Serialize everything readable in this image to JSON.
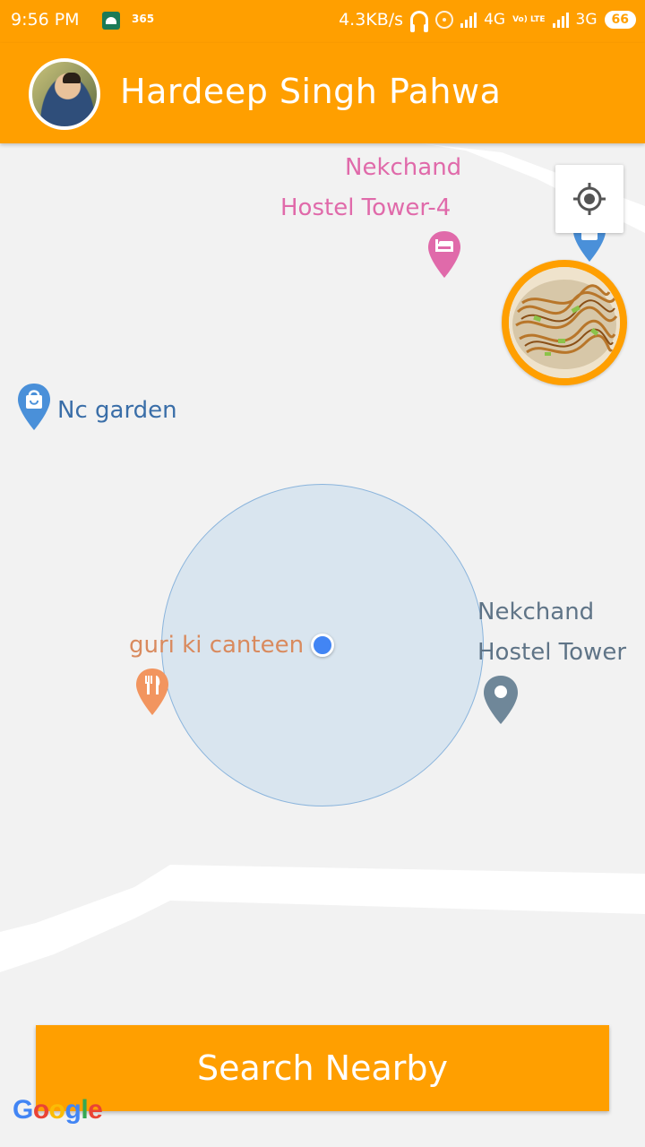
{
  "status_bar": {
    "time": "9:56 PM",
    "app_badge": "365",
    "net_speed": "4.3KB/s",
    "net_type_1": "4G",
    "net_type_2": "3G",
    "volte": "Vo) LTE",
    "battery": "66"
  },
  "header": {
    "user_name": "Hardeep Singh Pahwa"
  },
  "map": {
    "places": [
      {
        "name_line1": "Nekchand",
        "name_line2": "Hostel Tower-4",
        "category": "hotel",
        "color": "#e06aaa"
      },
      {
        "name_line1": "Nc garden",
        "category": "shopping",
        "color": "#4a90d9"
      },
      {
        "name_line1": "guri ki canteen",
        "category": "restaurant",
        "color": "#f2955f"
      },
      {
        "name_line1": "Nekchand",
        "name_line2": "Hostel Tower",
        "category": "place",
        "color": "#6f8799"
      }
    ]
  },
  "search_button": {
    "label": "Search Nearby"
  },
  "attribution": {
    "letters": [
      "G",
      "o",
      "o",
      "g",
      "l",
      "e"
    ]
  },
  "colors": {
    "accent": "#ff9f00",
    "location_dot": "#4285f4"
  }
}
